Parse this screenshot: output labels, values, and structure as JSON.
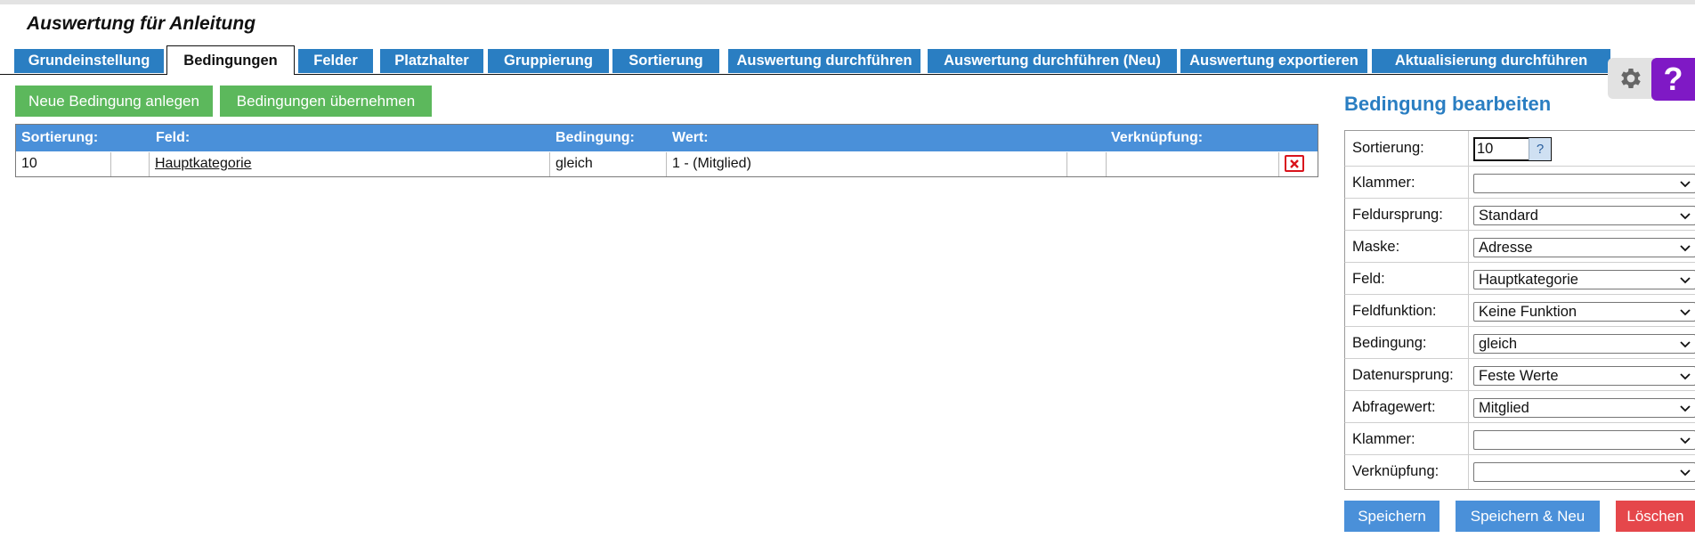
{
  "page": {
    "title": "Auswertung für Anleitung"
  },
  "tabs": [
    {
      "label": "Grundeinstellung",
      "active": false
    },
    {
      "label": "Bedingungen",
      "active": true
    },
    {
      "label": "Felder",
      "active": false
    },
    {
      "label": "Platzhalter",
      "active": false
    },
    {
      "label": "Gruppierung",
      "active": false
    },
    {
      "label": "Sortierung",
      "active": false
    },
    {
      "label": "Auswertung durchführen",
      "active": false
    },
    {
      "label": "Auswertung durchführen (Neu)",
      "active": false
    },
    {
      "label": "Auswertung exportieren",
      "active": false
    },
    {
      "label": "Aktualisierung durchführen",
      "active": false
    }
  ],
  "side_icons": {
    "settings": "gear-icon",
    "help_label": "?"
  },
  "actions": {
    "new_condition": "Neue Bedingung anlegen",
    "apply_conditions": "Bedingungen übernehmen"
  },
  "conditions_table": {
    "headers": {
      "sort": "Sortierung:",
      "field": "Feld:",
      "condition": "Bedingung:",
      "value": "Wert:",
      "link": "Verknüpfung:"
    },
    "rows": [
      {
        "sort": "10",
        "field": "Hauptkategorie",
        "condition": "gleich",
        "value": "1 - (Mitglied)",
        "link": ""
      }
    ]
  },
  "edit_panel": {
    "title": "Bedingung bearbeiten",
    "help_hint": "?",
    "fields": {
      "sort": {
        "label": "Sortierung:",
        "value": "10"
      },
      "bracket1": {
        "label": "Klammer:",
        "value": ""
      },
      "origin": {
        "label": "Feldursprung:",
        "value": "Standard"
      },
      "mask": {
        "label": "Maske:",
        "value": "Adresse"
      },
      "field": {
        "label": "Feld:",
        "value": "Hauptkategorie"
      },
      "function": {
        "label": "Feldfunktion:",
        "value": "Keine Funktion"
      },
      "condition": {
        "label": "Bedingung:",
        "value": "gleich"
      },
      "data_origin": {
        "label": "Datenursprung:",
        "value": "Feste Werte"
      },
      "query_value": {
        "label": "Abfragewert:",
        "value": "Mitglied"
      },
      "bracket2": {
        "label": "Klammer:",
        "value": ""
      },
      "link": {
        "label": "Verknüpfung:",
        "value": ""
      }
    },
    "buttons": {
      "save": "Speichern",
      "save_new": "Speichern & Neu",
      "delete": "Löschen"
    }
  },
  "colors": {
    "tab": "#2a7ec2",
    "table_header": "#4a90d9",
    "green_button": "#5cb85c",
    "blue_button": "#4a90d9",
    "red_button": "#e5474b",
    "help": "#7f19c5"
  }
}
